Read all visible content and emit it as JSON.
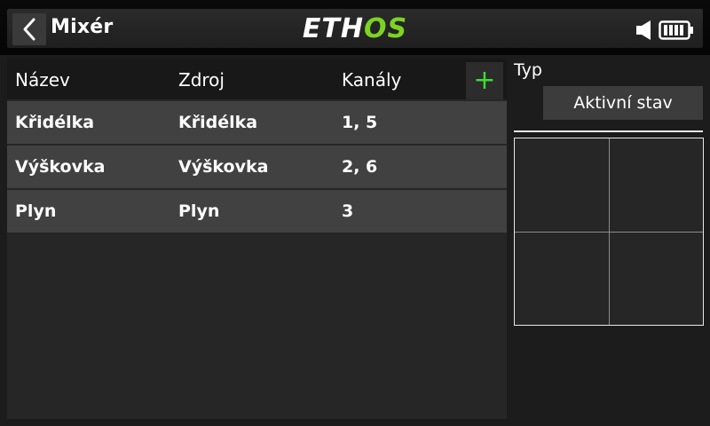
{
  "header": {
    "title": "Mixér",
    "logo_left": "ETH",
    "logo_right": "OS",
    "back_icon": "chevron-left-icon",
    "status_icons": [
      "speaker-icon",
      "battery-icon"
    ]
  },
  "table": {
    "columns": [
      "Název",
      "Zdroj",
      "Kanály"
    ],
    "add_label": "+",
    "rows": [
      {
        "name": "Křidélka",
        "source": "Křidélka",
        "channels": "1, 5"
      },
      {
        "name": "Výškovka",
        "source": "Výškovka",
        "channels": "2, 6"
      },
      {
        "name": "Plyn",
        "source": "Plyn",
        "channels": "3"
      }
    ]
  },
  "right_panel": {
    "type_label": "Typ",
    "state_button": "Aktivní stav"
  },
  "colors": {
    "accent_green": "#3ddc35",
    "logo_green": "#7dd321"
  }
}
